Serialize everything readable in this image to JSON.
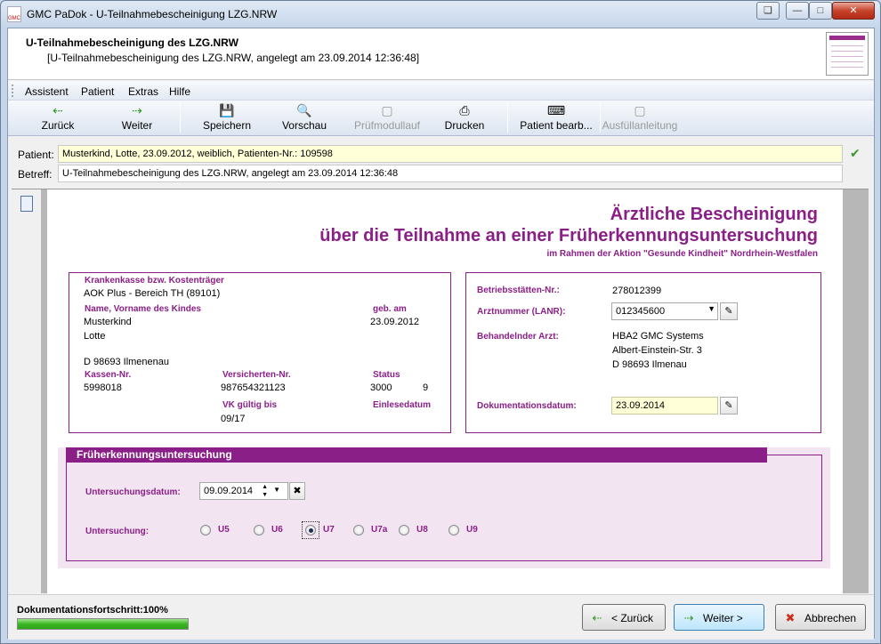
{
  "window": {
    "title": "GMC PaDok  -  U-Teilnahmebescheinigung LZG.NRW",
    "app_icon_text": "GMC"
  },
  "header": {
    "title": "U-Teilnahmebescheinigung des LZG.NRW",
    "subtitle": "[U-Teilnahmebescheinigung des LZG.NRW, angelegt am 23.09.2014 12:36:48]"
  },
  "menu": [
    "Assistent",
    "Patient",
    "Extras",
    "Hilfe"
  ],
  "toolbar": {
    "back": "Zurück",
    "forward": "Weiter",
    "save": "Speichern",
    "preview": "Vorschau",
    "check": "Prüfmodullauf",
    "print": "Drucken",
    "patient_edit": "Patient bearb...",
    "help_fill": "Ausfüllanleitung"
  },
  "fields": {
    "patient_label": "Patient:",
    "patient_value": "Musterkind, Lotte,  23.09.2012,  weiblich,  Patienten-Nr.: 109598",
    "subject_label": "Betreff:",
    "subject_value": "U-Teilnahmebescheinigung des LZG.NRW, angelegt am 23.09.2014 12:36:48"
  },
  "form": {
    "title_line1": "Ärztliche Bescheinigung",
    "title_line2": "über die Teilnahme an einer Früherkennungsuntersuchung",
    "subtitle": "im Rahmen der Aktion \"Gesunde Kindheit\" Nordrhein-Westfalen",
    "left": {
      "insurer_label": "Krankenkasse bzw. Kostenträger",
      "insurer_value": "AOK Plus - Bereich TH (89101)",
      "name_label": "Name, Vorname des Kindes",
      "dob_label": "geb. am",
      "lastname": "Musterkind",
      "firstname": "Lotte",
      "dob": "23.09.2012",
      "address": "D 98693 Ilmenenau",
      "kassen_label": "Kassen-Nr.",
      "kassen_value": "5998018",
      "versicherten_label": "Versicherten-Nr.",
      "versicherten_value": "987654321123",
      "status_label": "Status",
      "status_value": "3000",
      "status_extra": "9",
      "vk_label": "VK gültig bis",
      "vk_value": "09/17",
      "einlese_label": "Einlesedatum"
    },
    "right": {
      "bsnr_label": "Betriebsstätten-Nr.:",
      "bsnr_value": "278012399",
      "lanr_label": "Arztnummer (LANR):",
      "lanr_value": "012345600",
      "doctor_label": "Behandelnder Arzt:",
      "doctor_line1": "HBA2 GMC Systems",
      "doctor_line2": "Albert-Einstein-Str. 3",
      "doctor_line3": "D 98693 Ilmenau",
      "docdate_label": "Dokumentationsdatum:",
      "docdate_value": "23.09.2014"
    },
    "section": {
      "title": "Früherkennungsuntersuchung",
      "date_label": "Untersuchungsdatum:",
      "date_value": "09.09.2014",
      "exam_label": "Untersuchung:",
      "options": [
        "U5",
        "U6",
        "U7",
        "U7a",
        "U8",
        "U9"
      ],
      "selected": "U7"
    }
  },
  "status": {
    "progress_label": "Dokumentationsfortschritt:100%",
    "progress_percent": 100,
    "back_button": "< Zurück",
    "next_button": "Weiter >",
    "cancel_button": "Abbrechen"
  }
}
